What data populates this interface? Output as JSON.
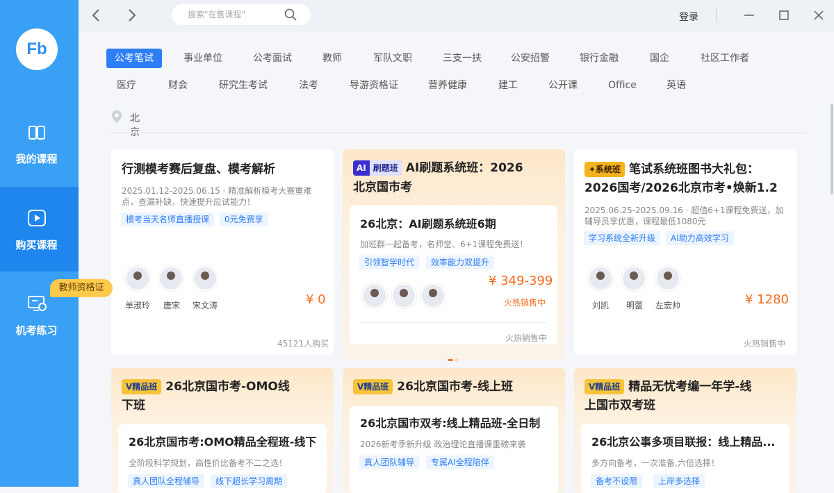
{
  "sidebar": {
    "logo": "Fb",
    "items": [
      {
        "label": "我的课程",
        "icon": "book-icon"
      },
      {
        "label": "购买课程",
        "icon": "play-icon"
      },
      {
        "label": "机考练习",
        "icon": "monitor-clock-icon"
      }
    ],
    "badge": "教师资格证"
  },
  "topbar": {
    "search_placeholder": "搜索\"在售课程\"",
    "login": "登录"
  },
  "categories_row1": [
    "公考笔试",
    "事业单位",
    "公考面试",
    "教师",
    "军队文职",
    "三支一扶",
    "公安招警",
    "银行金融",
    "国企",
    "社区工作者"
  ],
  "categories_row2": [
    "医疗",
    "财会",
    "研究生考试",
    "法考",
    "导游资格证",
    "营养健康",
    "建工",
    "公开课",
    "Office",
    "英语"
  ],
  "location": "北京",
  "cards": [
    {
      "title": "行测模考赛后复盘、模考解析",
      "desc": "2025.01.12-2025.06.15 · 精准解析模考大赛重难点，查漏补缺，快速提升应试能力！",
      "tags": [
        "模考当天名师直播授课",
        "0元免费享"
      ],
      "teachers": [
        "单淑玲",
        "唐宋",
        "宋文涛"
      ],
      "price": "¥ 0",
      "bought": "45121人购买"
    },
    {
      "badge": "AI 刷题班",
      "title": "AI刷题系统班：2026",
      "title2": "北京国市考",
      "inner_title": "26北京：AI刷题系统班6期",
      "desc": "加班群一起备考，名师堂、6+1课程免费送！",
      "tags": [
        "引领智学时代",
        "效率能力双提升"
      ],
      "price": "¥ 349-399",
      "status": "火热销售中",
      "footer": "火热销售中"
    },
    {
      "badge": "系统班",
      "title": "笔试系统班图书大礼包：",
      "title2": "2026国考/2026北京市考•焕新1.2",
      "desc": "2025.06.25-2025.09.16 · 超值6+1课程免费送，加辅导员享优惠，课程最低1080元",
      "tags": [
        "学习系统全新升级",
        "AI助力高效学习"
      ],
      "teachers": [
        "刘凯",
        "明蕾",
        "左宏帅"
      ],
      "price": "¥ 1280",
      "footer": "火热销售中"
    },
    {
      "badge": "精品班",
      "title": "26北京国市考-OMO线",
      "title2": "下班",
      "inner_title": "26北京国市考:OMO精品全程班-线下",
      "desc": "全阶段科学规划，高性价比备考不二之选！",
      "tags": [
        "真人团队全程辅导",
        "线下超长学习周期"
      ]
    },
    {
      "badge": "精品班",
      "title": "26北京国市考-线上班",
      "inner_title": "26北京国市双考:线上精品班-全日制",
      "desc": "2026新考季新升级 政治理论直播课重磅来袭",
      "tags": [
        "真人团队辅导",
        "专属AI全程陪伴"
      ]
    },
    {
      "badge": "精品班",
      "title": "精品无忧考编一年学-线",
      "title2": "上国市双考班",
      "inner_title": "26北京公事多项目联报：线上精品...",
      "desc": "多方向备考，一次准备,六倍选择！",
      "tags": [
        "备考不设限",
        "上岸多选择"
      ]
    }
  ],
  "colors": {
    "sidebar": "#3aa0f5",
    "sidebar_active": "#1f86ee",
    "accent": "#2d7ef7",
    "price": "#f46a1c",
    "badge": "#ffc94a"
  }
}
